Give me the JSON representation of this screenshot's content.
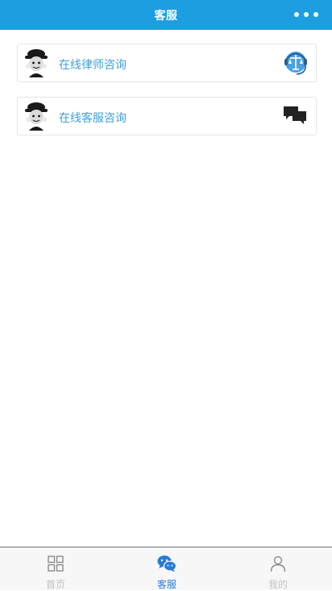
{
  "header": {
    "title": "客服"
  },
  "cards": [
    {
      "label": "在线律师咨询",
      "icon": "lawyer-scales-icon"
    },
    {
      "label": "在线客服咨询",
      "icon": "chat-bubbles-icon"
    }
  ],
  "tabbar": {
    "items": [
      {
        "label": "首页",
        "icon": "grid-icon",
        "active": false
      },
      {
        "label": "客服",
        "icon": "wechat-icon",
        "active": true
      },
      {
        "label": "我的",
        "icon": "user-icon",
        "active": false
      }
    ]
  },
  "colors": {
    "header_bg": "#1c9ee0",
    "card_text": "#3f9fd8",
    "tab_active": "#2b7bd6",
    "tab_inactive": "#c2c2c2"
  }
}
